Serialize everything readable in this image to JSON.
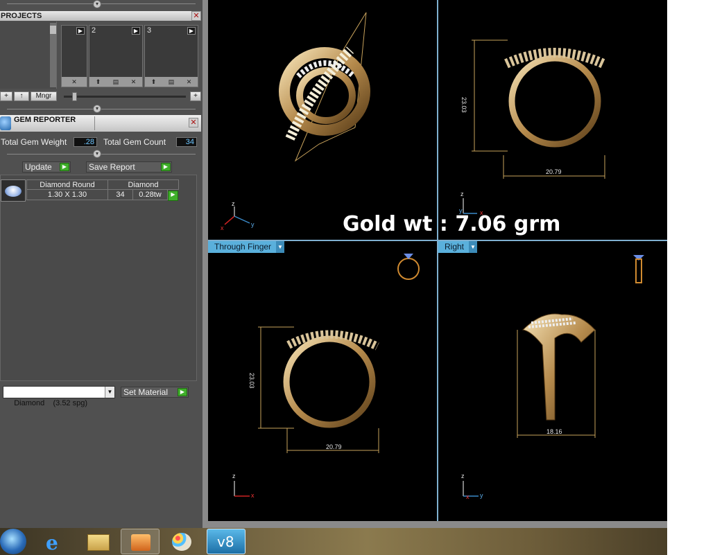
{
  "projects": {
    "title": "PROJECTS",
    "slots": [
      "2",
      "3"
    ],
    "buttons": {
      "add": "+",
      "up": "↑",
      "manager": "Mngr"
    }
  },
  "gem_reporter": {
    "title": "GEM REPORTER",
    "total_weight_label": "Total Gem Weight",
    "total_weight_value": ".28",
    "total_count_label": "Total Gem Count",
    "total_count_value": "34",
    "update_label": "Update",
    "save_report_label": "Save Report",
    "table": {
      "headers": [
        "Diamond Round",
        "Diamond"
      ],
      "rows": [
        {
          "size": "1.30 X 1.30",
          "count": "34",
          "weight": "0.28tw"
        }
      ]
    },
    "material_value": "Diamond    (3.52 spg)",
    "set_material_label": "Set Material"
  },
  "viewport": {
    "gold_weight_text": "Gold wt : 7.06 grm",
    "views": [
      {
        "id": "perspective",
        "axes": [
          "z",
          "x",
          "y"
        ]
      },
      {
        "id": "front",
        "axes": [
          "z",
          "y",
          "x"
        ],
        "dims": {
          "height": "23.03",
          "width": "20.79"
        }
      },
      {
        "id": "through-finger",
        "label": "Through Finger",
        "axes": [
          "z",
          "x"
        ],
        "dims": {
          "height": "23.03",
          "width": "20.79"
        }
      },
      {
        "id": "right",
        "label": "Right",
        "axes": [
          "z",
          "x",
          "y"
        ],
        "dims": {
          "width": "18.16"
        }
      }
    ]
  },
  "taskbar": {
    "items": [
      "start-orb-icon",
      "internet-explorer-icon",
      "file-explorer-icon",
      "media-player-icon",
      "paint-icon",
      "v8-app-icon"
    ]
  },
  "colors": {
    "panel_bg": "#505050",
    "viewport_bg": "#000000",
    "view_label_bg": "#5ab0dc",
    "gold": "#c9a35c",
    "go_green": "#3fae2a"
  }
}
